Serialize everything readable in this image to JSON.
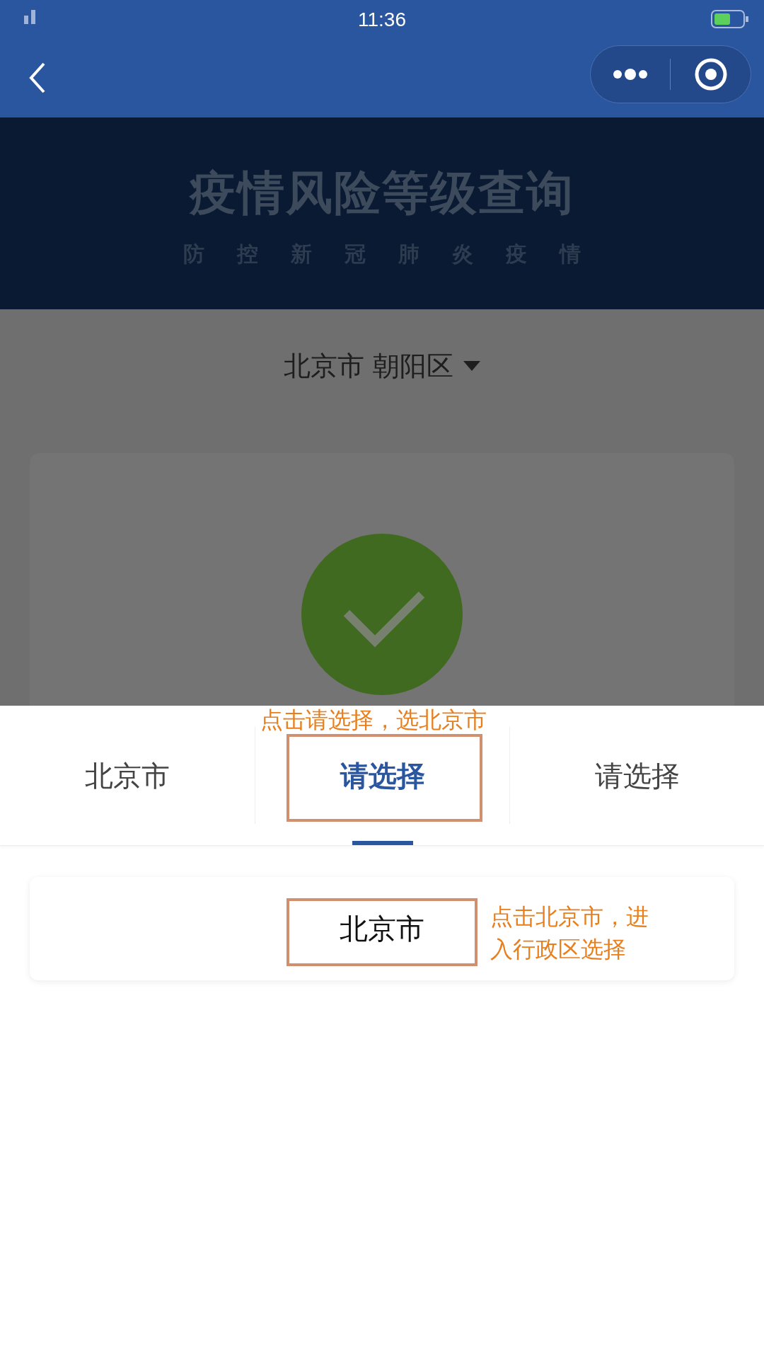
{
  "status_bar": {
    "time": "11:36"
  },
  "header": {
    "title": "疫情风险等级查询",
    "subtitle": "防控新冠肺炎疫情"
  },
  "location": {
    "text": "北京市 朝阳区"
  },
  "result": {
    "kind": "ok"
  },
  "tabs": [
    {
      "label": "北京市",
      "selected": false
    },
    {
      "label": "请选择",
      "selected": true
    },
    {
      "label": "请选择",
      "selected": false
    }
  ],
  "options": [
    {
      "label": "北京市"
    }
  ],
  "annotations": [
    "点击请选择，选北京市",
    "点击北京市，进入行政区选择"
  ]
}
